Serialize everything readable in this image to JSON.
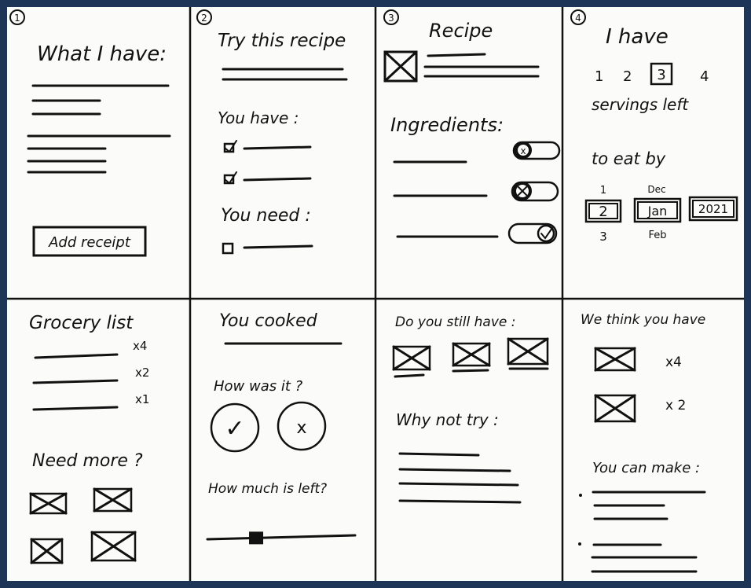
{
  "panels": {
    "p1": {
      "number": "1",
      "title": "What I have:",
      "button": "Add receipt"
    },
    "p2": {
      "number": "2",
      "title": "Try this recipe",
      "have": "You have :",
      "need": "You need :"
    },
    "p3": {
      "number": "3",
      "title": "Recipe",
      "ingredients": "Ingredients:"
    },
    "p4": {
      "number": "4",
      "title": "I have",
      "servings": [
        "1",
        "2",
        "3",
        "4"
      ],
      "servings_selected": "3",
      "servings_label": "servings left",
      "eat_by": "to eat by",
      "day_above": "1",
      "day": "2",
      "day_below": "3",
      "month_above": "Dec",
      "month": "Jan",
      "month_below": "Feb",
      "year": "2021"
    },
    "p5": {
      "title": "Grocery list",
      "qty": [
        "x4",
        "x2",
        "x1"
      ],
      "need_more": "Need more ?"
    },
    "p6": {
      "title": "You cooked",
      "how": "How was it ?",
      "yes": "✓",
      "no": "x",
      "left": "How much is left?",
      "slider_fraction": 0.33
    },
    "p7": {
      "title": "Do you still have :",
      "why": "Why not try :"
    },
    "p8": {
      "title": "We think you have",
      "qty": [
        "x4",
        "x 2"
      ],
      "make": "You can make :"
    }
  }
}
